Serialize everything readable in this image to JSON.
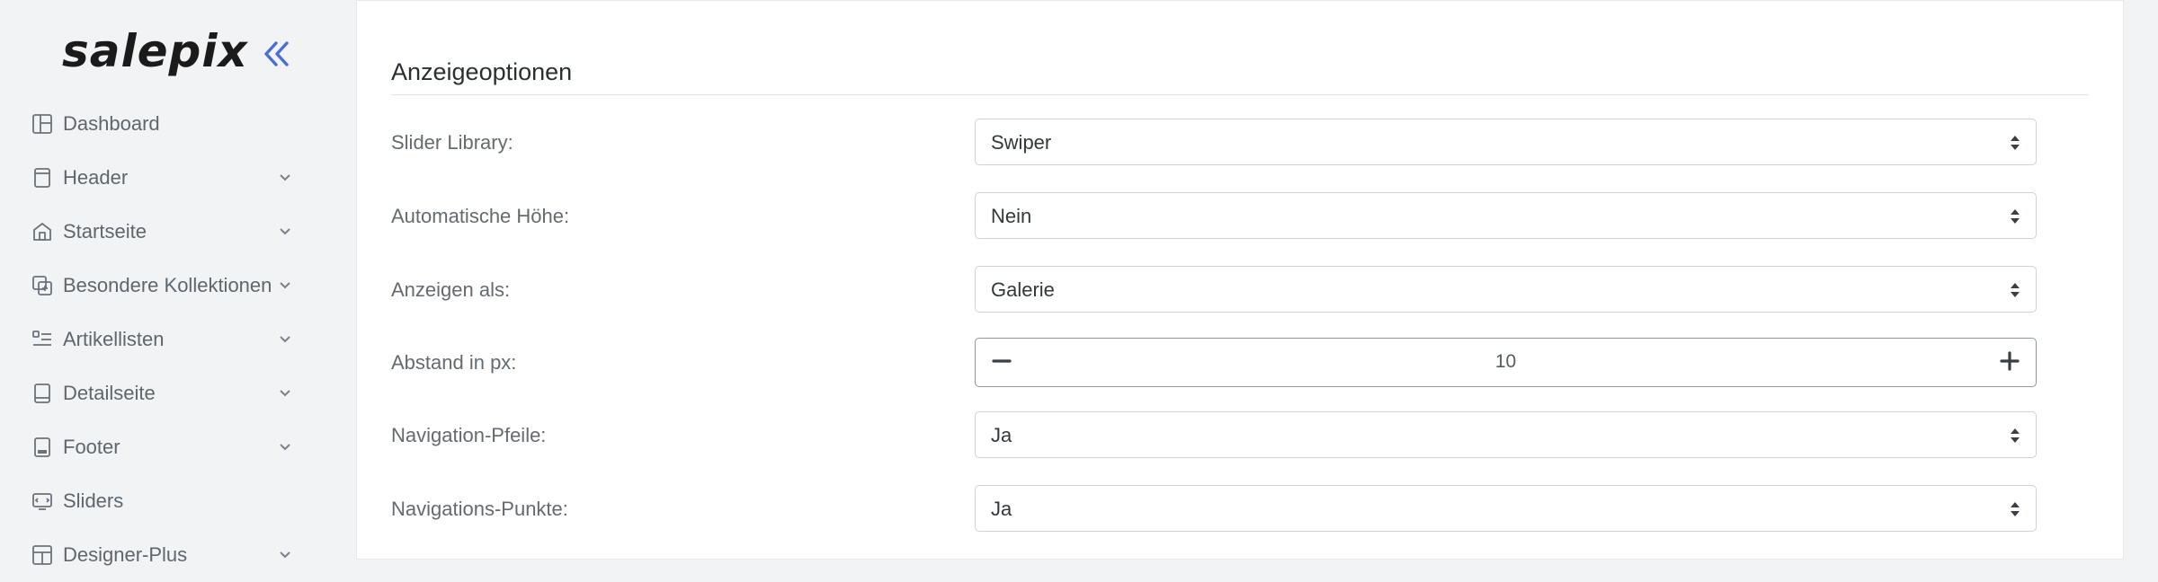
{
  "brand": {
    "logo_text": "salepix"
  },
  "sidebar": {
    "items": [
      {
        "label": "Dashboard",
        "icon": "dashboard-icon",
        "has_submenu": false
      },
      {
        "label": "Header",
        "icon": "header-icon",
        "has_submenu": true
      },
      {
        "label": "Startseite",
        "icon": "home-icon",
        "has_submenu": true
      },
      {
        "label": "Besondere Kollektionen",
        "icon": "collections-icon",
        "has_submenu": true
      },
      {
        "label": "Artikellisten",
        "icon": "list-icon",
        "has_submenu": true
      },
      {
        "label": "Detailseite",
        "icon": "detail-page-icon",
        "has_submenu": true
      },
      {
        "label": "Footer",
        "icon": "footer-icon",
        "has_submenu": true
      },
      {
        "label": "Sliders",
        "icon": "slider-icon",
        "has_submenu": false
      },
      {
        "label": "Designer-Plus",
        "icon": "designer-icon",
        "has_submenu": true
      }
    ]
  },
  "section": {
    "title": "Anzeigeoptionen",
    "fields": [
      {
        "label": "Slider Library:",
        "type": "select",
        "value": "Swiper"
      },
      {
        "label": "Automatische Höhe:",
        "type": "select",
        "value": "Nein"
      },
      {
        "label": "Anzeigen als:",
        "type": "select",
        "value": "Galerie"
      },
      {
        "label": "Abstand in px:",
        "type": "stepper",
        "value": "10"
      },
      {
        "label": "Navigation-Pfeile:",
        "type": "select",
        "value": "Ja"
      },
      {
        "label": "Navigations-Punkte:",
        "type": "select",
        "value": "Ja"
      }
    ]
  },
  "colors": {
    "sidebar_bg": "#f1f3f5",
    "accent": "#4a6fd1",
    "panel_bg": "#ffffff"
  }
}
